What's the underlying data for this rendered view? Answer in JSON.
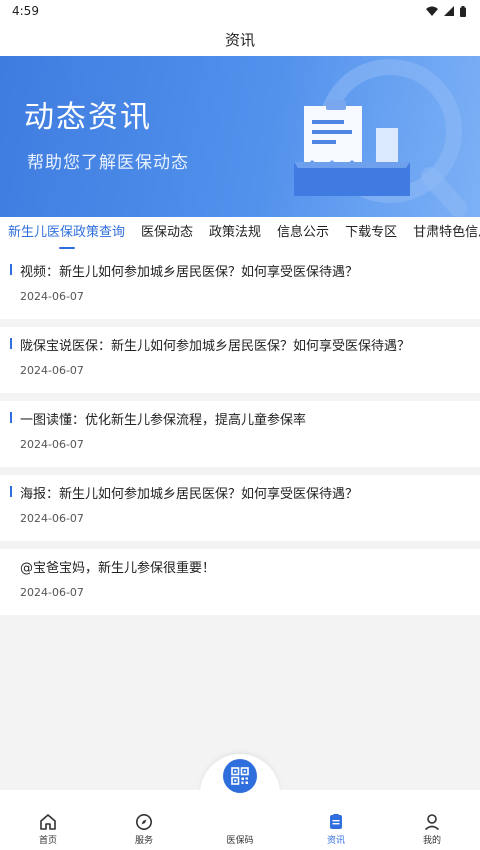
{
  "status_bar": {
    "time": "4:59"
  },
  "header": {
    "title": "资讯"
  },
  "banner": {
    "title": "动态资讯",
    "subtitle": "帮助您了解医保动态"
  },
  "tabs": [
    {
      "label": "新生儿医保政策查询",
      "active": true
    },
    {
      "label": "医保动态"
    },
    {
      "label": "政策法规"
    },
    {
      "label": "信息公示"
    },
    {
      "label": "下载专区"
    },
    {
      "label": "甘肃特色信息"
    }
  ],
  "articles": [
    {
      "title": "视频：新生儿如何参加城乡居民医保？如何享受医保待遇？",
      "date": "2024-06-07"
    },
    {
      "title": "陇保宝说医保：新生儿如何参加城乡居民医保？如何享受医保待遇？",
      "date": "2024-06-07"
    },
    {
      "title": "一图读懂：优化新生儿参保流程，提高儿童参保率",
      "date": "2024-06-07"
    },
    {
      "title": "海报：新生儿如何参加城乡居民医保？如何享受医保待遇？",
      "date": "2024-06-07"
    },
    {
      "title": "@宝爸宝妈，新生儿参保很重要！",
      "date": "2024-06-07"
    }
  ],
  "bottom_nav": {
    "items": [
      {
        "label": "首页",
        "icon": "home-icon"
      },
      {
        "label": "服务",
        "icon": "compass-icon"
      },
      {
        "label": "医保码",
        "icon": "qr-code-icon"
      },
      {
        "label": "资讯",
        "icon": "news-icon",
        "active": true
      },
      {
        "label": "我的",
        "icon": "user-icon"
      }
    ]
  },
  "colors": {
    "accent": "#2f6fdd",
    "banner_start": "#3f7ce0",
    "banner_end": "#7db1f6",
    "background": "#f3f3f3"
  }
}
